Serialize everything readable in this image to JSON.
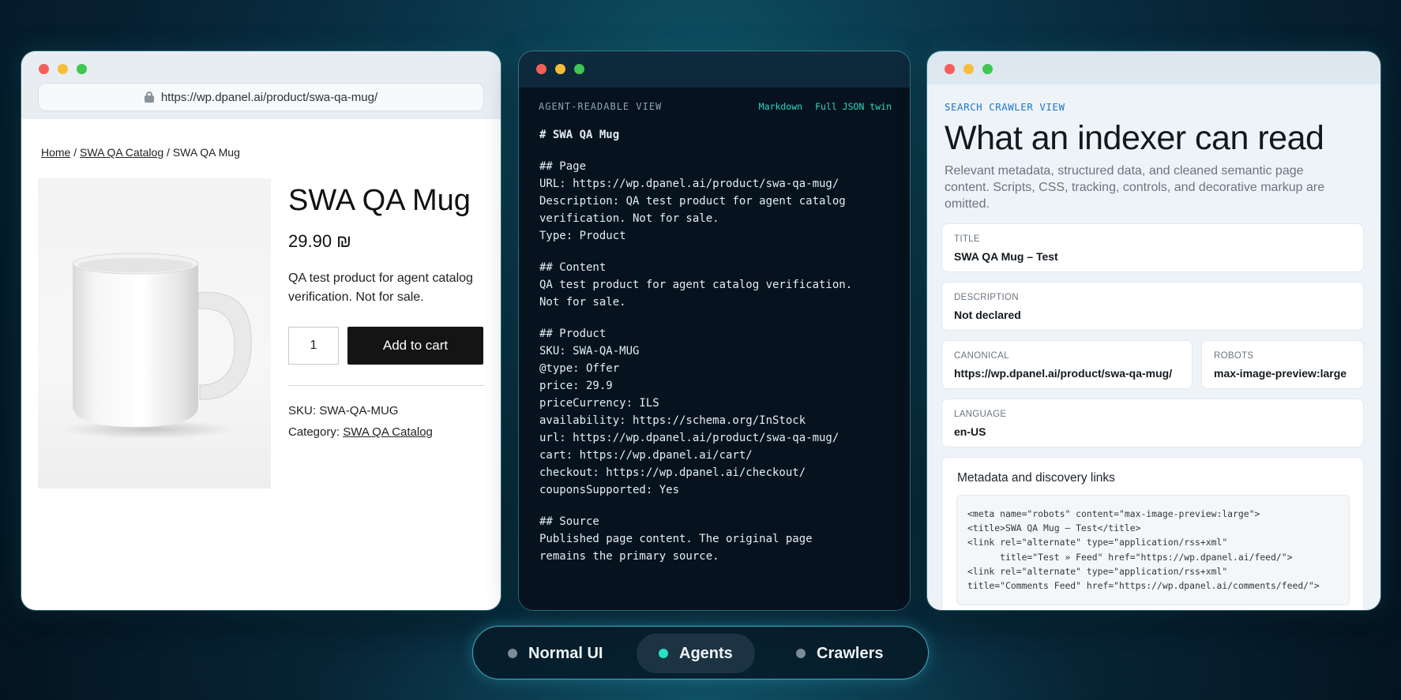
{
  "normal_ui": {
    "url": "https://wp.dpanel.ai/product/swa-qa-mug/",
    "breadcrumb": {
      "home": "Home",
      "sep": "/",
      "catalog": "SWA QA Catalog",
      "current": "SWA QA Mug"
    },
    "product": {
      "title": "SWA QA Mug",
      "price": "29.90 ₪",
      "description": "QA test product for agent catalog verification. Not for sale.",
      "quantity": "1",
      "add_to_cart": "Add to cart",
      "sku_label": "SKU:",
      "sku": "SWA-QA-MUG",
      "category_label": "Category:",
      "category": "SWA QA Catalog"
    }
  },
  "agent_view": {
    "header": "AGENT-READABLE VIEW",
    "links": [
      "Markdown",
      "Full JSON twin"
    ],
    "title_line": "# SWA QA Mug",
    "page": [
      "## Page",
      "URL: https://wp.dpanel.ai/product/swa-qa-mug/",
      "Description: QA test product for agent catalog",
      "verification. Not for sale.",
      "Type: Product"
    ],
    "content": [
      "## Content",
      "QA test product for agent catalog verification.",
      "Not for sale."
    ],
    "product": [
      "## Product",
      "SKU: SWA-QA-MUG",
      "@type: Offer",
      "price: 29.9",
      "priceCurrency: ILS",
      "availability: https://schema.org/InStock",
      "url: https://wp.dpanel.ai/product/swa-qa-mug/",
      "cart: https://wp.dpanel.ai/cart/",
      "checkout: https://wp.dpanel.ai/checkout/",
      "couponsSupported: Yes"
    ],
    "source": [
      "## Source",
      "Published page content. The original page",
      "remains the primary source."
    ]
  },
  "crawler_view": {
    "eyebrow": "SEARCH CRAWLER VIEW",
    "title": "What an indexer can read",
    "subtitle": "Relevant metadata, structured data, and cleaned semantic page content. Scripts, CSS, tracking, controls, and decorative markup are omitted.",
    "title_card": {
      "label": "TITLE",
      "value": "SWA QA Mug – Test"
    },
    "description_card": {
      "label": "DESCRIPTION",
      "value": "Not declared"
    },
    "canonical_card": {
      "label": "CANONICAL",
      "value": "https://wp.dpanel.ai/product/swa-qa-mug/"
    },
    "robots_card": {
      "label": "ROBOTS",
      "value": "max-image-preview:large"
    },
    "language_card": {
      "label": "LANGUAGE",
      "value": "en-US"
    },
    "links_card": {
      "title": "Metadata and discovery links",
      "code": [
        "<meta name=\"robots\" content=\"max-image-preview:large\">",
        "<title>SWA QA Mug – Test</title>",
        "<link rel=\"alternate\" type=\"application/rss+xml\"",
        "      title=\"Test » Feed\" href=\"https://wp.dpanel.ai/feed/\">",
        "<link rel=\"alternate\" type=\"application/rss+xml\"",
        "title=\"Comments Feed\" href=\"https://wp.dpanel.ai/comments/feed/\">"
      ]
    }
  },
  "switcher": {
    "options": [
      {
        "label": "Normal UI",
        "active": false
      },
      {
        "label": "Agents",
        "active": true
      },
      {
        "label": "Crawlers",
        "active": false
      }
    ]
  },
  "colors": {
    "accent": "#26e1c2",
    "agent_link": "#2fd8c1",
    "crawler_eyebrow": "#2078c8",
    "button": "#141414"
  }
}
